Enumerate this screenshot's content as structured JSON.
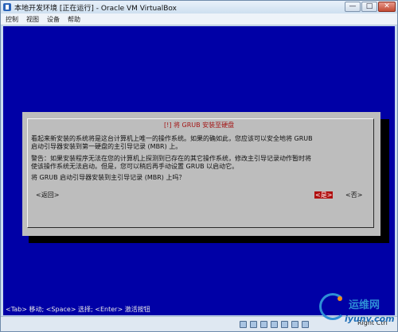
{
  "window": {
    "title": "本地开发环境 [正在运行] - Oracle VM VirtualBox",
    "minimize": "—",
    "maximize": "□",
    "close": "✕"
  },
  "menu": [
    "控制",
    "视图",
    "设备",
    "帮助"
  ],
  "dialog": {
    "title": "[!] 将 GRUB 安装至硬盘",
    "para1_line1": "看起来新安装的系统将是这台计算机上唯一的操作系统。如果的确如此，您应该可以安全地将 GRUB",
    "para1_line2": "启动引导器安装到第一硬盘的主引导记录 (MBR) 上。",
    "para2_line1": "警告：如果安装程序无法在您的计算机上探测到已存在的其它操作系统，修改主引导记录动作暂时将",
    "para2_line2": "使该操作系统无法启动。但是，您可以稍后再手动设置 GRUB 以启动它。",
    "question": "将 GRUB 启动引导器安装到主引导记录 (MBR) 上吗？",
    "back_label": "<返回>",
    "yes_label": "<是>",
    "no_label": "<否>"
  },
  "help_line": "<Tab> 移动; <Space> 选择; <Enter> 激活按钮",
  "statusbar": {
    "host_key": "Right Ctrl"
  },
  "watermark": {
    "text": "运维网",
    "url": "iyunv.com"
  },
  "colors": {
    "screen_blue": "#0000a6",
    "dialog_gray": "#bdbdbd",
    "title_red": "#a31515",
    "selected_red": "#b01010"
  }
}
